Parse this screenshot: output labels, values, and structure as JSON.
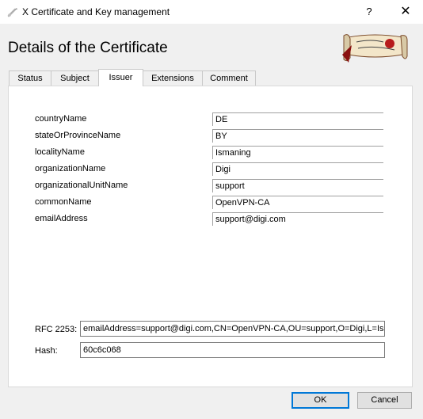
{
  "window": {
    "title": "X Certificate and Key management",
    "help_label": "?",
    "close_label": "✕"
  },
  "header": {
    "title": "Details of the Certificate"
  },
  "tabs": [
    {
      "label": "Status",
      "active": false
    },
    {
      "label": "Subject",
      "active": false
    },
    {
      "label": "Issuer",
      "active": true
    },
    {
      "label": "Extensions",
      "active": false
    },
    {
      "label": "Comment",
      "active": false
    }
  ],
  "issuer": {
    "fields": [
      {
        "label": "countryName",
        "value": "DE"
      },
      {
        "label": "stateOrProvinceName",
        "value": "BY"
      },
      {
        "label": "localityName",
        "value": "Ismaning"
      },
      {
        "label": "organizationName",
        "value": "Digi"
      },
      {
        "label": "organizationalUnitName",
        "value": "support"
      },
      {
        "label": "commonName",
        "value": "OpenVPN-CA"
      },
      {
        "label": "emailAddress",
        "value": "support@digi.com"
      }
    ],
    "rfc_label": "RFC 2253:",
    "rfc_value": "emailAddress=support@digi.com,CN=OpenVPN-CA,OU=support,O=Digi,L=Ismaning,ST=BY,C=DE",
    "hash_label": "Hash:",
    "hash_value": "60c6c068"
  },
  "buttons": {
    "ok": "OK",
    "cancel": "Cancel"
  },
  "colors": {
    "accent": "#0078d7",
    "background": "#f0f0f0"
  }
}
